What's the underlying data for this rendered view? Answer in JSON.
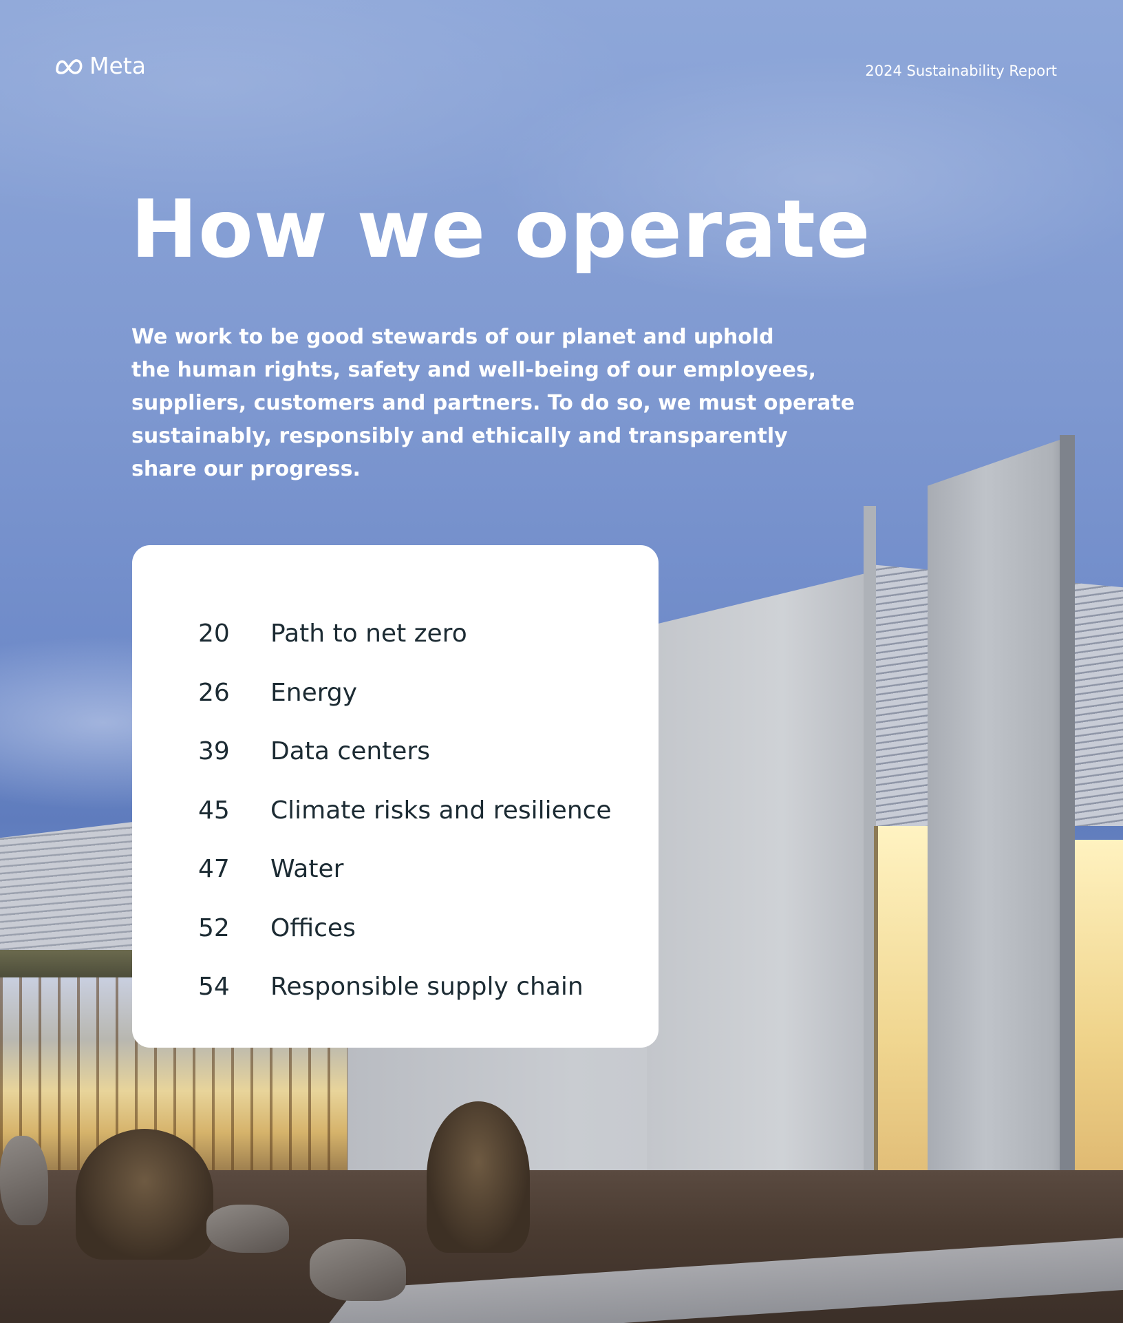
{
  "header": {
    "brand": "Meta",
    "report_title": "2024 Sustainability Report"
  },
  "page": {
    "title": "How we operate",
    "intro_lines": [
      "We work to be good stewards of our planet and uphold",
      "the human rights, safety and well-being of our employees,",
      "suppliers, customers and partners. To do so, we must operate",
      "sustainably, responsibly and ethically and transparently",
      "share our progress."
    ]
  },
  "toc": [
    {
      "page": "20",
      "label": "Path to net zero"
    },
    {
      "page": "26",
      "label": "Energy"
    },
    {
      "page": "39",
      "label": "Data centers"
    },
    {
      "page": "45",
      "label": "Climate risks and resilience"
    },
    {
      "page": "47",
      "label": "Water"
    },
    {
      "page": "52",
      "label": "Offices"
    },
    {
      "page": "54",
      "label": "Responsible supply chain"
    }
  ],
  "icons": {
    "logo": "meta-infinity-icon"
  },
  "colors": {
    "text_on_photo": "#ffffff",
    "toc_text": "#1c2b33",
    "toc_background": "#ffffff"
  }
}
